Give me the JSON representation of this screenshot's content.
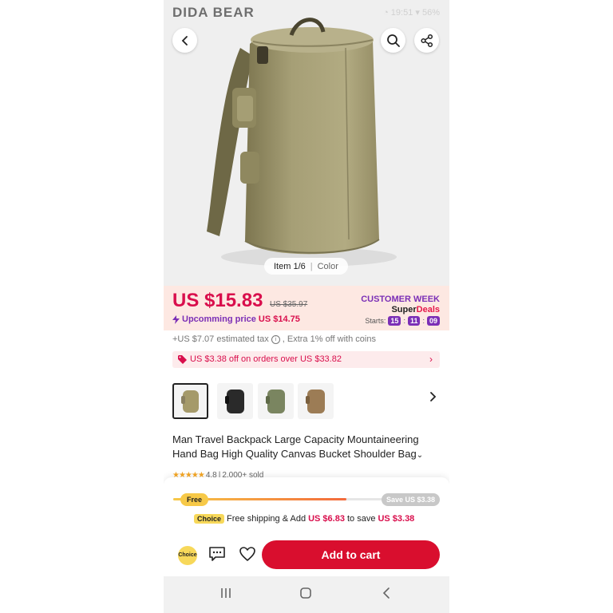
{
  "status": {
    "brand": "DIDA BEAR",
    "right": "◔ 19:51 ▾ 56%"
  },
  "gallery": {
    "index_label": "Item 1/6",
    "tab_label": "Color"
  },
  "price": {
    "current": "US $15.83",
    "original": "US $35.97",
    "upcoming_label": "Upcomming price",
    "upcoming_value": "US $14.75",
    "promo_title": "CUSTOMER WEEK",
    "promo_super": "Super",
    "promo_deals": "Deals",
    "timer_label": "Starts:",
    "timer": [
      "15",
      "11",
      "09"
    ],
    "timer_sep": ":"
  },
  "tax_line": "+US $7.07 estimated tax",
  "tax_extra": ", Extra 1% off with coins",
  "coupon": {
    "text": "US $3.38 off on orders over US $33.82",
    "arrow": "›"
  },
  "variants": [
    {
      "name": "khaki",
      "color": "#a59a6a"
    },
    {
      "name": "black",
      "color": "#2a2a2a"
    },
    {
      "name": "army-green",
      "color": "#7a8560"
    },
    {
      "name": "brown",
      "color": "#9c7c55"
    }
  ],
  "product": {
    "title": "Man Travel Backpack Large Capacity Mountaineering Hand Bag High Quality Canvas Bucket Shoulder Bag",
    "rating_stars": "★★★★★",
    "rating": "4.8",
    "rating_sep": "|",
    "sold": "2,000+ sold"
  },
  "shipping": {
    "free_label": "Free",
    "save_label": "Save US $3.38",
    "progress": 0.65,
    "choice_badge": "Choice",
    "text_a": "Free shipping & Add",
    "add_amount": "US $6.83",
    "text_b": "to save",
    "save_amount": "US $3.38"
  },
  "actions": {
    "choice_label": "Choice",
    "cart_label": "Add to cart"
  },
  "nav": {
    "recents": "|||",
    "home": "○",
    "back": "‹"
  },
  "colors": {
    "accent_red": "#d90e2e",
    "price_red": "#d90e4c",
    "purple": "#7b2fb6",
    "choice_yellow": "#f7d85a"
  }
}
